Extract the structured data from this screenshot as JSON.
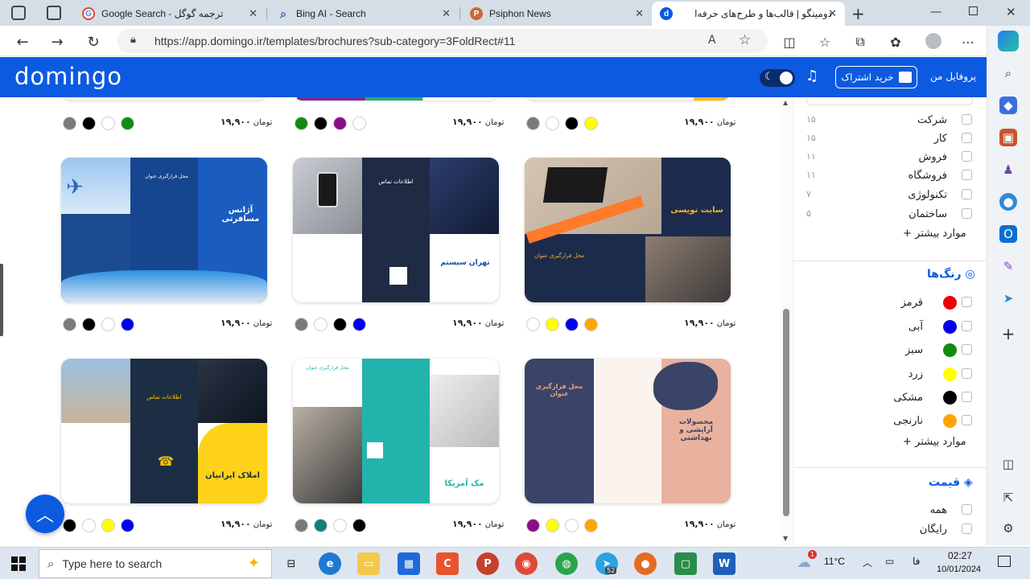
{
  "browser": {
    "tabs": [
      {
        "label": "Google Search - ترجمه گوگل",
        "icon": "google-icon"
      },
      {
        "label": "Bing AI - Search",
        "icon": "search-icon"
      },
      {
        "label": "Psiphon News",
        "icon": "psiphon-icon"
      },
      {
        "label": "دومینگو | قالب‌ها و طرح‌های حرفه‌ا",
        "icon": "domingo-icon"
      }
    ],
    "url": "https://app.domingo.ir/templates/brochures?sub-category=3FoldRect#11"
  },
  "site": {
    "logo": "domingo",
    "subscribe_label": "خرید اشتراک",
    "profile_label": "پروفایل من"
  },
  "cards": [
    {
      "price": "۱۹,۹۰۰",
      "currency": "تومان",
      "colors": [
        "#7a7a7a",
        "#000000",
        "#ffffff",
        "#118c11"
      ]
    },
    {
      "price": "۱۹,۹۰۰",
      "currency": "تومان",
      "colors": [
        "#118c11",
        "#000000",
        "#8a0e8a",
        "#ffffff"
      ]
    },
    {
      "price": "۱۹,۹۰۰",
      "currency": "تومان",
      "colors": [
        "#7a7a7a",
        "#ffffff",
        "#000000",
        "#ffff00"
      ]
    },
    {
      "price": "۱۹,۹۰۰",
      "currency": "تومان",
      "colors": [
        "#7a7a7a",
        "#000000",
        "#ffffff",
        "#0000ee"
      ],
      "title": "آژانس مسافرتی",
      "heading": "محل فرارگیری عنوان"
    },
    {
      "price": "۱۹,۹۰۰",
      "currency": "تومان",
      "colors": [
        "#7a7a7a",
        "#ffffff",
        "#000000",
        "#0000ee"
      ],
      "title": "تهران سیستم",
      "heading": "اطلاعات تماس"
    },
    {
      "price": "۱۹,۹۰۰",
      "currency": "تومان",
      "colors": [
        "#ffffff",
        "#ffff00",
        "#0000ee",
        "#ffa500"
      ],
      "title": "سایت نویسی",
      "heading": "محل فرارگیری عنوان"
    },
    {
      "price": "۱۹,۹۰۰",
      "currency": "تومان",
      "colors": [
        "#000000",
        "#ffffff",
        "#ffff00",
        "#0000ee"
      ],
      "title": "املاک ایرانیان",
      "heading": "اطلاعات تماس"
    },
    {
      "price": "۱۹,۹۰۰",
      "currency": "تومان",
      "colors": [
        "#7a7a7a",
        "#0f7f7f",
        "#ffffff",
        "#000000"
      ],
      "title": "مک آمریکا",
      "heading": "محل فرارگیری عنوان"
    },
    {
      "price": "۱۹,۹۰۰",
      "currency": "تومان",
      "colors": [
        "#8a0e8a",
        "#ffff00",
        "#ffffff",
        "#ffa500"
      ],
      "title": "محصولات آرایشی و بهداشتی",
      "heading": "محل فرارگیری عنوان"
    }
  ],
  "filters": {
    "categories": [
      {
        "label": "شرکت",
        "count": "۱۵"
      },
      {
        "label": "کار",
        "count": "۱۵"
      },
      {
        "label": "فروش",
        "count": "۱۱"
      },
      {
        "label": "فروشگاه",
        "count": "۱۱"
      },
      {
        "label": "تکنولوژی",
        "count": "۷"
      },
      {
        "label": "ساختمان",
        "count": "۵"
      }
    ],
    "more_label": "موارد بیشتر",
    "colors_title": "رنگ‌ها",
    "colors": [
      {
        "label": "قرمز",
        "hex": "#ee0000"
      },
      {
        "label": "آبی",
        "hex": "#0000ee"
      },
      {
        "label": "سبز",
        "hex": "#118c11"
      },
      {
        "label": "زرد",
        "hex": "#ffff00"
      },
      {
        "label": "مشکی",
        "hex": "#000000"
      },
      {
        "label": "نارنجی",
        "hex": "#ffa500"
      }
    ],
    "price_title": "قیمت",
    "price_options": [
      "همه",
      "رایگان"
    ]
  },
  "taskbar": {
    "search_placeholder": "Type here to search",
    "temperature": "11°C",
    "lang": "فا",
    "time": "02:27",
    "date": "10/01/2024",
    "weather_badge": "1",
    "telegram_badge": "52"
  }
}
